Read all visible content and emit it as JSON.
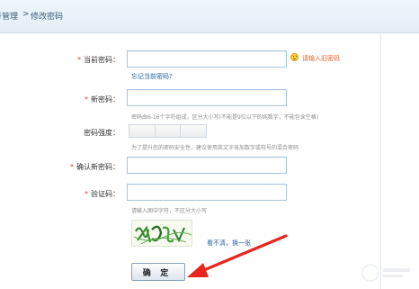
{
  "breadcrumb": {
    "parent": "帐号管理",
    "separator": ">",
    "current": "修改密码"
  },
  "form": {
    "current_password": {
      "label": "当前密码：",
      "value": "",
      "warning": "请输入旧密码",
      "forgot_link": "忘记当前密码?"
    },
    "new_password": {
      "label": "新密码：",
      "value": "",
      "hint": "密码由6-16个字符组成，区分大小写(不能是9位以下的纯数字，不能包含空格)"
    },
    "strength": {
      "label": "密码强度：",
      "level": 0,
      "segments": 3,
      "hint": "为了提升您的密码安全性，建议使用英文字母加数字或符号的混合密码"
    },
    "confirm_password": {
      "label": "确认新密码：",
      "value": ""
    },
    "captcha": {
      "label": "验证码：",
      "value": "",
      "hint": "请输入图中字符，不区分大小写",
      "refresh_prefix": "看不清",
      "refresh_separator": "，",
      "refresh_link": "换一张"
    },
    "submit_label": "确 定"
  },
  "colors": {
    "required_star": "#e0453a",
    "link": "#1f5f9e",
    "warning": "#e0642a",
    "input_border": "#a6c5e2",
    "arrow": "#e8261f"
  }
}
